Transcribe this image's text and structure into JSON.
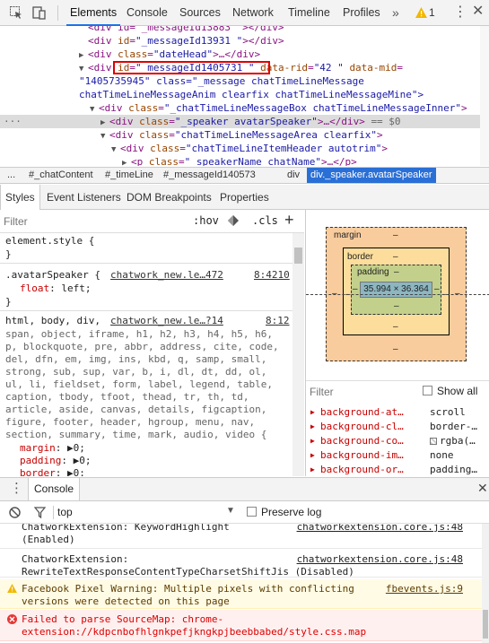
{
  "toolbar": {
    "tabs": [
      "Elements",
      "Console",
      "Sources",
      "Network",
      "Timeline",
      "Profiles"
    ],
    "warning_count": "1"
  },
  "tree": {
    "row0": "<div id=\"_messageId13883        \"></div>",
    "row1_tag_open": "<div",
    "row1_attr": "id",
    "row1_val": "\"_messageId13931      \"",
    "row1_end": "></div>",
    "row2_tag_open": "<div",
    "row2_attr": "class",
    "row2_val": "\"dateHead\"",
    "row2_end": ">…</div>",
    "row3_tag_open": "<div",
    "row3_attr": "id",
    "row3_val": "\"_messageId1405731        \"",
    "row3_attr2": "data-rid",
    "row3_val2": "\"42        \"",
    "row3_attr3": "data-mid",
    "row4": "\"1405735945\" class=\"_message chatTimeLineMessage",
    "row5": "chatTimeLineMessageAnim clearfix chatTimeLineMessageMine\">",
    "row6_attr": "class",
    "row6_val": "\"_chatTimeLineMessageBox chatTimeLineMessageInner\"",
    "row7_attr": "class",
    "row7_val": "\"_speaker avatarSpeaker\"",
    "row7_end": ">…</div>",
    "row7_eq": "== $0",
    "row8_attr": "class",
    "row8_val": "\"chatTimeLineMessageArea clearfix\"",
    "row9_attr": "class",
    "row9_val": "\"chatTimeLineItemHeader autotrim\"",
    "row10_tag": "<p",
    "row10_attr": "class",
    "row10_val": "\"_speakerName chatName\"",
    "row10_end": ">…</p>",
    "div": "<div",
    "close": ">"
  },
  "breadcrumbs": [
    "...",
    "#_chatContent",
    "#_timeLine",
    "#_messageId140573",
    "div",
    "div._speaker.avatarSpeaker"
  ],
  "subtabs": [
    "Styles",
    "Event Listeners",
    "DOM Breakpoints",
    "Properties"
  ],
  "styles": {
    "filter_placeholder": "Filter",
    "hov": ":hov",
    "cls": ".cls",
    "plus": "+",
    "element_style": "element.style {",
    "close_brace": "}",
    "rule1_selector": ".avatarSpeaker {",
    "rule1_source": "chatwork_new.le…472",
    "rule1_line": "8:4210",
    "rule1_prop": "float",
    "rule1_value": "left;",
    "rule2_selector": "html, body, div,",
    "rule2_source": "chatwork_new.le…?14",
    "rule2_line": "8:12",
    "rule2_lines": [
      "span, object, iframe, h1, h2, h3, h4, h5, h6,",
      "p, blockquote, pre, abbr, address, cite, code,",
      "del, dfn, em, img, ins, kbd, q, samp, small,",
      "strong, sub, sup, var, b, i, dl, dt, dd, ol,",
      "ul, li, fieldset, form, label, legend, table,",
      "caption, tbody, tfoot, thead, tr, th, td,",
      "article, aside, canvas, details, figcaption,",
      "figure, footer, header, hgroup, menu, nav,",
      "section, summary, time, mark, audio, video {"
    ],
    "rule2_props": [
      {
        "name": "margin",
        "value": "0;"
      },
      {
        "name": "padding",
        "value": "0;"
      },
      {
        "name": "border",
        "value": "0;"
      }
    ]
  },
  "boxmodel": {
    "margin_label": "margin",
    "border_label": "border",
    "padding_label": "padding",
    "dash": "–",
    "content": "35.994 × 36.364"
  },
  "computed": {
    "filter_placeholder": "Filter",
    "show_all": "Show all",
    "props": [
      {
        "name": "background-at…",
        "value": "scroll"
      },
      {
        "name": "background-cl…",
        "value": "border-…"
      },
      {
        "name": "background-co…",
        "value": "rgba(…"
      },
      {
        "name": "background-im…",
        "value": "none"
      },
      {
        "name": "background-or…",
        "value": "padding…"
      }
    ]
  },
  "console": {
    "tab_label": "Console",
    "context": "top",
    "preserve_log": "Preserve log",
    "messages": [
      {
        "type": "log",
        "text": "ChatworkExtension: KeywordHighlight",
        "text2": "(Enabled)",
        "source": "chatworkextension.core.js:48"
      },
      {
        "type": "log",
        "text": "ChatworkExtension:",
        "text2": "RewriteTextResponseContentTypeCharsetShiftJis (Disabled)",
        "source": "chatworkextension.core.js:48"
      },
      {
        "type": "warning",
        "text": "Facebook Pixel Warning: Multiple pixels with conflicting",
        "text2": "versions were detected on this page",
        "source": "fbevents.js:9"
      },
      {
        "type": "error",
        "text": "Failed to parse SourceMap: chrome-",
        "text2": "extension://kdpcnbofhlgnkpefjkngkpjbeebbabed/style.css.map",
        "source": ""
      }
    ]
  },
  "colors": {
    "accent": "#1a73e8",
    "selected_crumb": "#2a6fd6",
    "annotation_box": "#e00000",
    "margin": "#f9cc9d",
    "border": "#fddd9b",
    "padding": "#c3d08b",
    "content": "#8cb6c0"
  }
}
